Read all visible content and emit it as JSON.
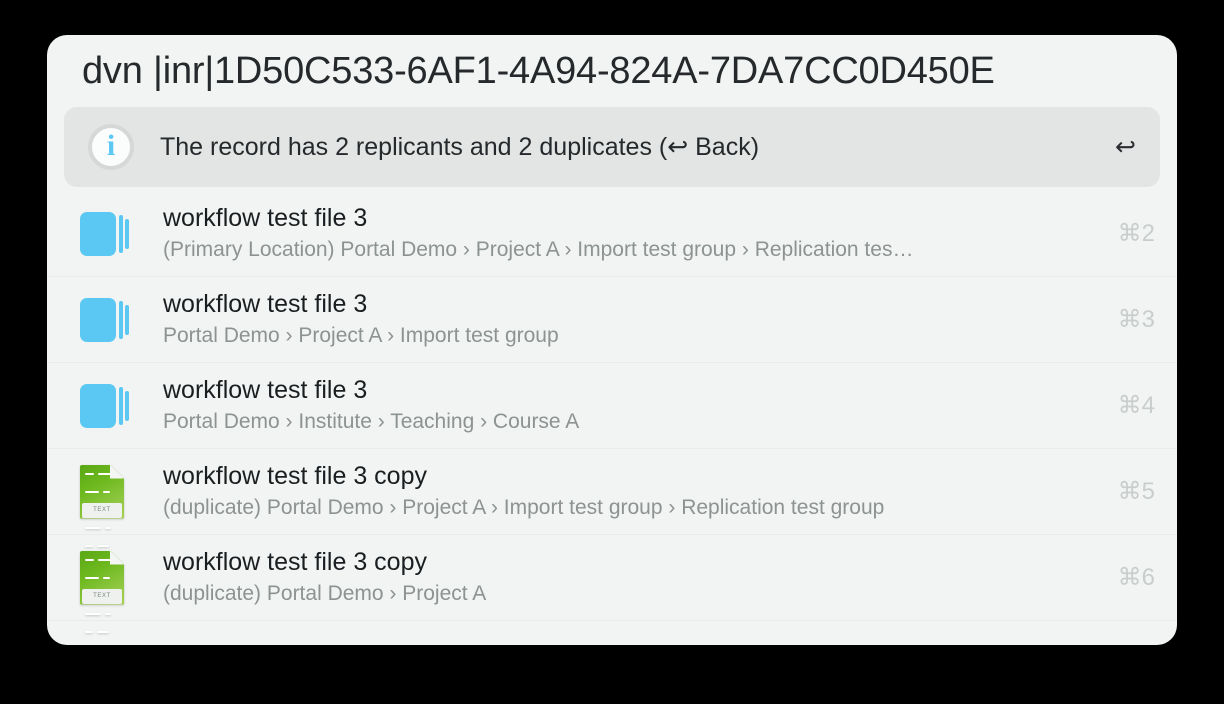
{
  "window": {
    "title": "dvn |inr|1D50C533-6AF1-4A94-824A-7DA7CC0D450E",
    "background_color": "#f1f4f3",
    "canvas_color": "#000000"
  },
  "banner": {
    "icon": "info-circle-icon",
    "message": "The record has 2 replicants and 2 duplicates  (↩ Back)",
    "return_glyph": "↩",
    "background_color": "#e2e5e4",
    "accent_color": "#5ec8f5"
  },
  "results": [
    {
      "icon": "stack-icon",
      "title": "workflow test file 3",
      "path": "(Primary Location) Portal Demo › Project A › Import test group › Replication tes…",
      "shortcut": "⌘2"
    },
    {
      "icon": "stack-icon",
      "title": "workflow test file 3",
      "path": "Portal Demo › Project A › Import test group",
      "shortcut": "⌘3"
    },
    {
      "icon": "stack-icon",
      "title": "workflow test file 3",
      "path": "Portal Demo › Institute › Teaching › Course A",
      "shortcut": "⌘4"
    },
    {
      "icon": "text-document-icon",
      "icon_label": "TEXT",
      "title": "workflow test file 3 copy",
      "path": "(duplicate) Portal Demo › Project A › Import test group › Replication test group",
      "shortcut": "⌘5"
    },
    {
      "icon": "text-document-icon",
      "icon_label": "TEXT",
      "title": "workflow test file 3 copy",
      "path": "(duplicate) Portal Demo › Project A",
      "shortcut": "⌘6"
    }
  ],
  "colors": {
    "stack_icon_blue": "#5ac8f2",
    "text_icon_green": "#8cc63f",
    "shortcut_gray": "#c9cecd",
    "subtitle_gray": "#8d9391"
  }
}
